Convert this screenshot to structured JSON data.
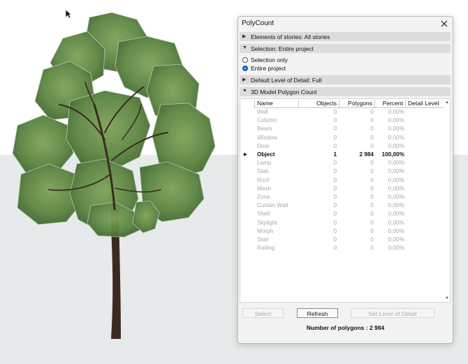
{
  "colors": {
    "accent": "#0a66c2",
    "dialog_bg": "#f3f3f3",
    "header_bg": "#dcdcdc"
  },
  "icons": {
    "cursor": "arrow-cursor-icon",
    "close": "close-icon",
    "collapsed": "triangle-right-icon",
    "expanded": "triangle-down-icon"
  },
  "dialog": {
    "title": "PolyCount",
    "sections": {
      "stories": "Elements of stories: All stories",
      "selection": "Selection: Entire project",
      "lod": "Default Level of Detail: Full",
      "count": "3D Model Polygon Count"
    },
    "selection_options": [
      {
        "label": "Selection only",
        "checked": false
      },
      {
        "label": "Entire project",
        "checked": true
      }
    ],
    "table": {
      "columns": [
        "Name",
        "Objects",
        "Polygons",
        "Percent",
        "Detail Level"
      ],
      "rows": [
        {
          "name": "Wall",
          "objects": "0",
          "polygons": "0",
          "percent": "0,00%"
        },
        {
          "name": "Column",
          "objects": "0",
          "polygons": "0",
          "percent": "0,00%"
        },
        {
          "name": "Beam",
          "objects": "0",
          "polygons": "0",
          "percent": "0,00%"
        },
        {
          "name": "Window",
          "objects": "0",
          "polygons": "0",
          "percent": "0,00%"
        },
        {
          "name": "Door",
          "objects": "0",
          "polygons": "0",
          "percent": "0,00%"
        },
        {
          "name": "Object",
          "objects": "1",
          "polygons": "2 984",
          "percent": "100,00%"
        },
        {
          "name": "Lamp",
          "objects": "0",
          "polygons": "0",
          "percent": "0,00%"
        },
        {
          "name": "Slab",
          "objects": "0",
          "polygons": "0",
          "percent": "0,00%"
        },
        {
          "name": "Roof",
          "objects": "0",
          "polygons": "0",
          "percent": "0,00%"
        },
        {
          "name": "Mesh",
          "objects": "0",
          "polygons": "0",
          "percent": "0,00%"
        },
        {
          "name": "Zone",
          "objects": "0",
          "polygons": "0",
          "percent": "0,00%"
        },
        {
          "name": "Curtain Wall",
          "objects": "0",
          "polygons": "0",
          "percent": "0,00%"
        },
        {
          "name": "Shell",
          "objects": "0",
          "polygons": "0",
          "percent": "0,00%"
        },
        {
          "name": "Skylight",
          "objects": "0",
          "polygons": "0",
          "percent": "0,00%"
        },
        {
          "name": "Morph",
          "objects": "0",
          "polygons": "0",
          "percent": "0,00%"
        },
        {
          "name": "Stair",
          "objects": "0",
          "polygons": "0",
          "percent": "0,00%"
        },
        {
          "name": "Railing",
          "objects": "0",
          "polygons": "0",
          "percent": "0,00%"
        }
      ]
    },
    "buttons": {
      "select": "Select",
      "refresh": "Refresh",
      "set_lod": "Set Level of Detail"
    },
    "polygon_count_text": "Number of polygons : 2 984"
  }
}
